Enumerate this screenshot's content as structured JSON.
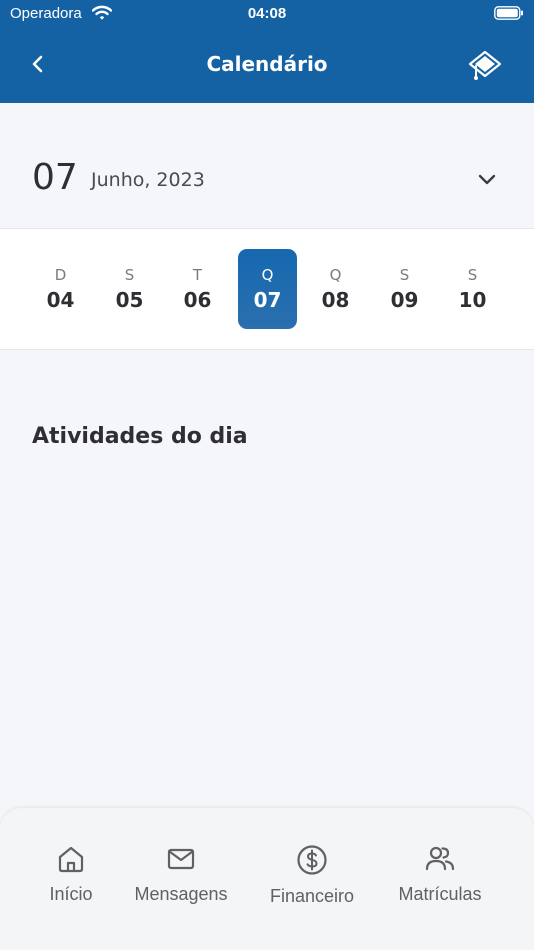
{
  "status_bar": {
    "carrier": "Operadora",
    "time": "04:08"
  },
  "header": {
    "title": "Calendário"
  },
  "date": {
    "day": "07",
    "month_year": "Junho, 2023"
  },
  "week": [
    {
      "weekday": "D",
      "day": "04",
      "selected": false
    },
    {
      "weekday": "S",
      "day": "05",
      "selected": false
    },
    {
      "weekday": "T",
      "day": "06",
      "selected": false
    },
    {
      "weekday": "Q",
      "day": "07",
      "selected": true
    },
    {
      "weekday": "Q",
      "day": "08",
      "selected": false
    },
    {
      "weekday": "S",
      "day": "09",
      "selected": false
    },
    {
      "weekday": "S",
      "day": "10",
      "selected": false
    }
  ],
  "activities": {
    "title": "Atividades do dia"
  },
  "tabs": [
    {
      "label": "Início",
      "icon": "home-icon"
    },
    {
      "label": "Mensagens",
      "icon": "mail-icon"
    },
    {
      "label": "Financeiro",
      "icon": "dollar-icon"
    },
    {
      "label": "Matrículas",
      "icon": "users-icon"
    }
  ],
  "colors": {
    "primary": "#1462a4",
    "background": "#f4f6fa",
    "text": "#2e2e33",
    "muted": "#7a7a80"
  }
}
